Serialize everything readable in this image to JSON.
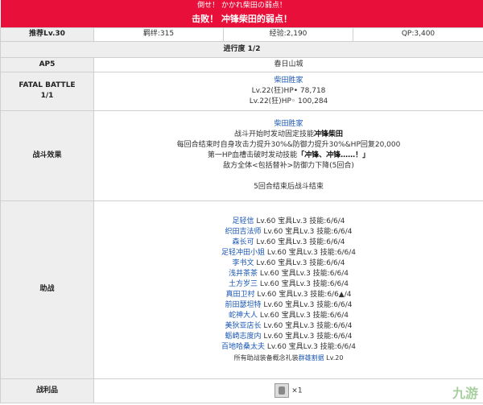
{
  "banner": {
    "subtitle": "倒せ！ かかれ柴田の弱点！",
    "title": "击败！ 冲锋柴田的弱点！"
  },
  "stats": {
    "recommend_label": "推荐Lv.30",
    "bond": "羁绊:315",
    "exp": "经验:2,190",
    "qp": "QP:3,400"
  },
  "progress": "进行度 1/2",
  "ap": {
    "label": "AP5",
    "location": "春日山城"
  },
  "fatal": {
    "label_line1": "FATAL BATTLE",
    "label_line2": "1/1",
    "enemy_name": "柴田胜家",
    "hp_rows": [
      "Lv.22(狂)HP• 78,718",
      "Lv.22(狂)HP◦ 100,284"
    ]
  },
  "effects": {
    "label": "战斗效果",
    "enemy_name": "柴田胜家",
    "line1_prefix": "战斗开始时发动固定技能",
    "line1_bold": "冲锋柴田",
    "line2": "每回合结束时自身攻击力提升30%&防御力提升30%&HP回复20,000",
    "line3_prefix": "第一HP血槽击破时发动技能",
    "line3_bold": "「冲锋、冲锋……！」",
    "line4": "敌方全体<包括替补>防御力下降(5回合)",
    "line5": "5回合结束后战斗结束"
  },
  "support": {
    "label": "助战",
    "servants": [
      {
        "name": "足轻信",
        "stats": " Lv.60 宝具Lv.3 技能:6/6/4"
      },
      {
        "name": "织田吉法师",
        "stats": " Lv.60 宝具Lv.3 技能:6/6/4"
      },
      {
        "name": "森长可",
        "stats": " Lv.60 宝具Lv.3 技能:6/6/4"
      },
      {
        "name": "足轻冲田小姐",
        "stats": " Lv.60 宝具Lv.3 技能:6/6/4"
      },
      {
        "name": "李书文",
        "stats": " Lv.60 宝具Lv.3 技能:6/6/4"
      },
      {
        "name": "浅井茶茶",
        "stats": " Lv.60 宝具Lv.3 技能:6/6/4"
      },
      {
        "name": "土方岁三",
        "stats": " Lv.60 宝具Lv.3 技能:6/6/4"
      },
      {
        "name": "真田卫村",
        "stats": " Lv.60 宝具Lv.3 技能:6/6▲/4"
      },
      {
        "name": "前田瑟坦特",
        "stats": " Lv.60 宝具Lv.3 技能:6/6/4"
      },
      {
        "name": "蛇神大人",
        "stats": " Lv.60 宝具Lv.3 技能:6/6/4"
      },
      {
        "name": "美狄亚店长",
        "stats": " Lv.60 宝具Lv.3 技能:6/6/4"
      },
      {
        "name": "蛎崎志度内",
        "stats": " Lv.60 宝具Lv.3 技能:6/6/4"
      },
      {
        "name": "百地哈桑太夫",
        "stats": " Lv.60 宝具Lv.3 技能:6/6/4"
      }
    ],
    "footer_prefix": "所有助战装备概念礼装",
    "footer_link": "群雄割据",
    "footer_suffix": " Lv.20"
  },
  "loot": {
    "label": "战利品",
    "count": "×1"
  },
  "watermark": "九游"
}
